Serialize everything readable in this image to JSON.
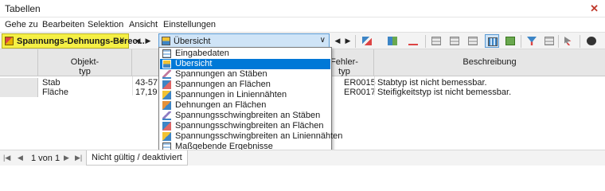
{
  "window": {
    "title": "Tabellen",
    "close_glyph": "✕"
  },
  "menu": [
    "Gehe zu",
    "Bearbeiten",
    "Selektion",
    "Ansicht",
    "Einstellungen"
  ],
  "toolbar": {
    "module_combo": {
      "label": "Spannungs-Dehnungs-Berec...",
      "icon": "module-icon",
      "color": "#f5f045"
    },
    "view_combo": {
      "label": "Übersicht",
      "icon": "overview-icon"
    },
    "nav_prev": "◀",
    "nav_next": "▶",
    "dropdown_arrow": "∨"
  },
  "table": {
    "headers": [
      "Objekt-\ntyp",
      "",
      "Fehler-\ntyp",
      "Beschreibung"
    ],
    "rows": [
      {
        "objekttyp": "Stab",
        "nr": "43-57,",
        "fehlertyp": "ER0015",
        "beschreibung": "Stabtyp ist nicht bemessbar."
      },
      {
        "objekttyp": "Fläche",
        "nr": "17,19",
        "fehlertyp": "ER0017",
        "beschreibung": "Steifigkeitstyp ist nicht bemessbar."
      }
    ]
  },
  "dropdown": {
    "items": [
      {
        "label": "Eingabedaten",
        "icon": "input-data-icon"
      },
      {
        "label": "Übersicht",
        "icon": "overview-icon",
        "selected": true
      },
      {
        "label": "Spannungen an Stäben",
        "icon": "member-stress-icon"
      },
      {
        "label": "Spannungen an Flächen",
        "icon": "surface-stress-icon"
      },
      {
        "label": "Spannungen in Liniennähten",
        "icon": "line-weld-stress-icon"
      },
      {
        "label": "Dehnungen an Flächen",
        "icon": "surface-strain-icon"
      },
      {
        "label": "Spannungsschwingbreiten an Stäben",
        "icon": "member-stress-range-icon"
      },
      {
        "label": "Spannungsschwingbreiten an Flächen",
        "icon": "surface-stress-range-icon"
      },
      {
        "label": "Spannungsschwingbreiten an Liniennähten",
        "icon": "line-weld-stress-range-icon"
      },
      {
        "label": "Maßgebende Ergebnisse",
        "icon": "governing-results-icon"
      }
    ]
  },
  "status": {
    "pages": "1 von 1",
    "tab": "Nicht gültig / deaktiviert"
  },
  "colors": {
    "accent": "#0078d7",
    "selection_bg": "#cfe4f7"
  }
}
